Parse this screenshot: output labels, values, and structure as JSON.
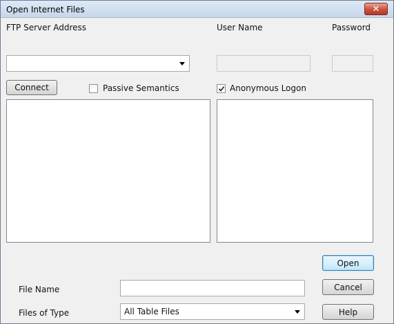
{
  "window": {
    "title": "Open Internet Files"
  },
  "icons": {
    "close": "close-icon",
    "dropdown": "chevron-down-icon",
    "check": "checkmark-icon"
  },
  "ftp": {
    "server_label": "FTP Server Address",
    "server_value": "",
    "user_label": "User Name",
    "user_value": "",
    "password_label": "Password",
    "password_value": ""
  },
  "options": {
    "connect_label": "Connect",
    "passive_label": "Passive Semantics",
    "passive_checked": false,
    "anonymous_label": "Anonymous Logon",
    "anonymous_checked": true
  },
  "lists": {
    "left_items": [],
    "right_items": []
  },
  "file": {
    "name_label": "File Name",
    "name_value": "",
    "type_label": "Files of Type",
    "type_value": "All Table Files"
  },
  "buttons": {
    "open": "Open",
    "cancel": "Cancel",
    "help": "Help"
  }
}
